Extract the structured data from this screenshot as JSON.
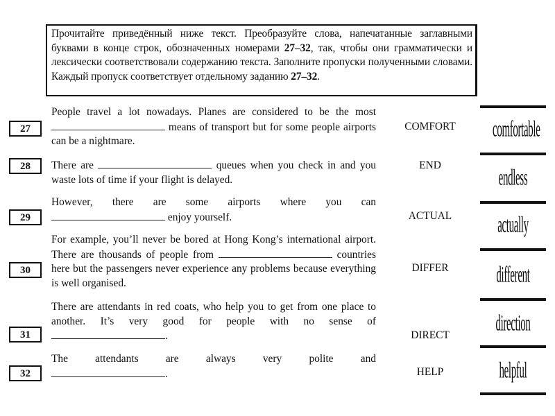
{
  "instructions": {
    "text_before_1": "Прочитайте приведённый ниже текст. Преобразуйте слова, напечатанные заглавными буквами в конце строк, обозначенных номерами ",
    "range_1": "27–32",
    "text_middle": ", так, чтобы они грамматически и лексически соответствовали содержанию текста. Заполните пропуски полученными словами. Каждый пропуск соответствует отдельному заданию ",
    "range_2": "27–32",
    "text_end": "."
  },
  "tasks": [
    {
      "number": "27",
      "before": "People travel a lot nowadays. Planes are considered to be the most",
      "after": "means of transport but for some people airports can be a nightmare.",
      "keyword": "COMFORT"
    },
    {
      "number": "28",
      "before": "There are",
      "after": "queues when you check in and you waste lots of time if your flight is delayed.",
      "keyword": "END"
    },
    {
      "number": "29",
      "before": "However, there are some airports where you can",
      "after": "enjoy yourself.",
      "keyword": "ACTUAL"
    },
    {
      "number": "30",
      "before": "For example, you’ll never be bored at Hong Kong’s international airport. There are thousands of people from",
      "after": "countries here but the passengers never experience any problems because everything is well organised.",
      "keyword": "DIFFER"
    },
    {
      "number": "31",
      "before": "There are attendants in red coats, who help you to get from one place to another. It’s very good for people with no sense of",
      "after": ".",
      "keyword": "DIRECT"
    },
    {
      "number": "32",
      "before": "The attendants are always very polite and",
      "after": ".",
      "keyword": "HELP"
    }
  ],
  "answers": [
    "comfortable",
    "endless",
    "actually",
    "different",
    "direction",
    "helpful"
  ]
}
